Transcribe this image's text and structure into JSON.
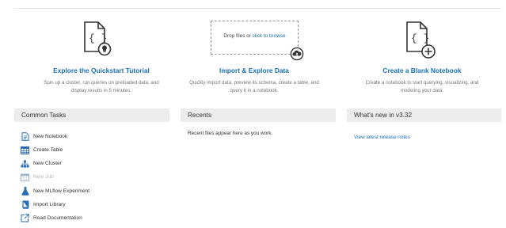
{
  "quickstart": {
    "title": "Explore the Quickstart Tutorial",
    "desc_line1": "Spin up a cluster, run queries on preloaded data, and",
    "desc_line2": "display results in 5 minutes."
  },
  "import": {
    "drop_text": "Drop files or ",
    "drop_link": "click to browse",
    "title": "Import & Explore Data",
    "desc_line1": "Quickly import data, preview its schema, create a table, and",
    "desc_line2": "query it in a notebook."
  },
  "blank": {
    "title": "Create a Blank Notebook",
    "desc_line1": "Create a notebook to start querying, visualizing, and",
    "desc_line2": "modeling your data."
  },
  "panels": {
    "common_tasks": "Common Tasks",
    "recents": "Recents",
    "whats_new": "What's new in v3.32"
  },
  "tasks": [
    {
      "label": "New Notebook",
      "icon": "notebook-icon",
      "enabled": true
    },
    {
      "label": "Create Table",
      "icon": "table-icon",
      "enabled": true
    },
    {
      "label": "New Cluster",
      "icon": "cluster-icon",
      "enabled": true
    },
    {
      "label": "New Job",
      "icon": "calendar-icon",
      "enabled": false
    },
    {
      "label": "New MLflow Experiment",
      "icon": "flask-icon",
      "enabled": true
    },
    {
      "label": "Import Library",
      "icon": "library-icon",
      "enabled": true
    },
    {
      "label": "Read Documentation",
      "icon": "external-link-icon",
      "enabled": true
    }
  ],
  "recents": {
    "empty_text": "Recent files appear here as you work."
  },
  "whats_new": {
    "link": "View latest release notes"
  },
  "colors": {
    "link": "#1b6fb7",
    "icon_blue": "#2a6db5",
    "panel_bg": "#ececec",
    "disabled": "#b9b9b9"
  }
}
